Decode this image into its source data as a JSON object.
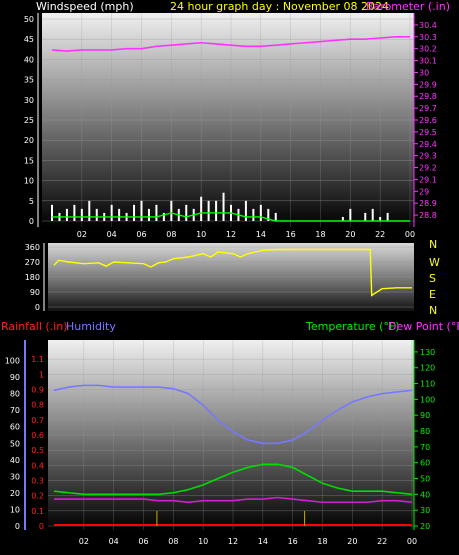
{
  "header": {
    "wind_label": "Windspeed (mph)",
    "date_label": "24 hour graph day : November 08 2024",
    "baro_label": "Barometer (.in)"
  },
  "lower_header": {
    "rain_label": "Rainfall (.in)",
    "humidity_label": "Humidity",
    "temp_label": "Temperature (°F)",
    "dew_label": "Dew Point (°F)"
  },
  "colors": {
    "wind": "#ffffff",
    "gust": "#00ff00",
    "barometer": "#ff33ff",
    "wind_dir": "#ffff00",
    "humidity": "#7878ff",
    "temperature": "#00dd00",
    "dewpoint": "#cc22cc",
    "rain": "#ff0000",
    "rain_rate": "#ccaa00",
    "date_label": "#ffff00",
    "header_white": "#ffffff"
  },
  "compass_labels": [
    "N",
    "W",
    "S",
    "E",
    "N"
  ],
  "chart_data": [
    {
      "type": "line",
      "title": "24 hour graph day : November 08 2024",
      "xlabel": "",
      "ylabel": "Windspeed (mph)",
      "x_ticks": [
        "02",
        "04",
        "06",
        "08",
        "10",
        "12",
        "14",
        "16",
        "18",
        "20",
        "22",
        "00"
      ],
      "ylim": [
        0,
        50
      ],
      "y_ticks": [
        0,
        5,
        10,
        15,
        20,
        25,
        30,
        35,
        40,
        45,
        50
      ],
      "y2label": "Barometer (.in)",
      "y2lim": [
        28.75,
        30.45
      ],
      "y2_ticks": [
        "28.8",
        "28.9",
        "29",
        "29.1",
        "29.2",
        "29.3",
        "29.4",
        "29.5",
        "29.6",
        "29.7",
        "29.8",
        "29.9",
        "30",
        "30.1",
        "30.2",
        "30.3",
        "30.4"
      ],
      "series": [
        {
          "name": "Barometer (.in)",
          "axis": "right",
          "x": [
            0,
            1,
            2,
            3,
            4,
            5,
            6,
            7,
            8,
            9,
            10,
            11,
            12,
            13,
            14,
            15,
            16,
            17,
            18,
            19,
            20,
            21,
            22,
            23,
            24
          ],
          "values": [
            30.19,
            30.18,
            30.19,
            30.19,
            30.19,
            30.2,
            30.2,
            30.22,
            30.23,
            30.24,
            30.25,
            30.24,
            30.23,
            30.22,
            30.22,
            30.23,
            30.24,
            30.25,
            30.26,
            30.27,
            30.28,
            30.28,
            30.29,
            30.3,
            30.3
          ]
        },
        {
          "name": "Windspeed (mph)",
          "axis": "left",
          "x": [
            0,
            0.5,
            1,
            1.5,
            2,
            2.5,
            3,
            3.5,
            4,
            4.5,
            5,
            5.5,
            6,
            6.5,
            7,
            7.5,
            8,
            8.5,
            9,
            9.5,
            10,
            10.5,
            11,
            11.5,
            12,
            12.5,
            13,
            13.5,
            14,
            14.5,
            15,
            16,
            17,
            18,
            19,
            19.5,
            20,
            20.5,
            21,
            21.5,
            22,
            22.5,
            23,
            24
          ],
          "values": [
            4,
            2,
            3,
            4,
            3,
            5,
            3,
            2,
            4,
            3,
            2,
            4,
            5,
            3,
            4,
            2,
            5,
            3,
            4,
            3,
            6,
            5,
            5,
            7,
            4,
            3,
            5,
            3,
            4,
            3,
            2,
            0,
            0,
            0,
            0,
            1,
            3,
            0,
            2,
            3,
            1,
            2,
            0,
            0
          ]
        },
        {
          "name": "Gust",
          "axis": "left",
          "x": [
            0,
            1,
            2,
            3,
            4,
            5,
            6,
            7,
            8,
            9,
            10,
            11,
            12,
            13,
            14,
            15,
            16,
            17,
            18,
            19,
            20,
            21,
            22,
            23,
            24
          ],
          "values": [
            1,
            1,
            1,
            1,
            1,
            1,
            1,
            1,
            2,
            1,
            2,
            2,
            2,
            1,
            1,
            0,
            0,
            0,
            0,
            0,
            0,
            0,
            0,
            0,
            0
          ]
        }
      ]
    },
    {
      "type": "line",
      "title": "",
      "ylabel": "Wind direction",
      "ylim": [
        0,
        360
      ],
      "y_ticks": [
        0,
        90,
        180,
        270,
        360
      ],
      "x_ticks": [],
      "series": [
        {
          "name": "Wind direction",
          "x": [
            0,
            0.3,
            1,
            2,
            3,
            3.5,
            4,
            5,
            6,
            6.5,
            7,
            7.5,
            8,
            9,
            9.5,
            10,
            10.5,
            11,
            12,
            12.5,
            13,
            13.5,
            14,
            15,
            16,
            17,
            18,
            19,
            20,
            21,
            21.2,
            21.3,
            22,
            23,
            24
          ],
          "values": [
            250,
            280,
            270,
            260,
            265,
            245,
            270,
            265,
            260,
            240,
            265,
            270,
            290,
            300,
            310,
            320,
            300,
            330,
            320,
            300,
            320,
            330,
            340,
            345,
            345,
            345,
            345,
            345,
            345,
            345,
            345,
            70,
            110,
            115,
            115
          ]
        }
      ]
    },
    {
      "type": "line",
      "title": "",
      "xlabel": "",
      "ylabel": "Rainfall (.in)",
      "x_ticks": [
        "02",
        "04",
        "06",
        "08",
        "10",
        "12",
        "14",
        "16",
        "18",
        "20",
        "22",
        "00"
      ],
      "ylim": [
        0,
        1.2
      ],
      "y_ticks": [
        "0",
        "0.1",
        "0.2",
        "0.3",
        "0.4",
        "0.5",
        "0.6",
        "0.7",
        "0.8",
        "0.9",
        "1",
        "1.1"
      ],
      "humidity_ticks": [
        0,
        10,
        20,
        30,
        40,
        50,
        60,
        70,
        80,
        90,
        100
      ],
      "y2label": "Temperature (°F)",
      "y2lim": [
        20,
        135
      ],
      "y2_ticks": [
        20,
        30,
        40,
        50,
        60,
        70,
        80,
        90,
        100,
        110,
        120,
        130
      ],
      "series": [
        {
          "name": "Humidity",
          "axis": "humidity",
          "x": [
            0,
            1,
            2,
            3,
            4,
            5,
            6,
            7,
            8,
            9,
            10,
            11,
            12,
            13,
            14,
            15,
            16,
            17,
            18,
            19,
            20,
            21,
            22,
            23,
            24
          ],
          "values": [
            82,
            84,
            85,
            85,
            84,
            84,
            84,
            84,
            83,
            80,
            73,
            64,
            57,
            52,
            50,
            50,
            52,
            57,
            64,
            70,
            75,
            78,
            80,
            81,
            82
          ]
        },
        {
          "name": "Temperature (°F)",
          "axis": "right",
          "x": [
            0,
            1,
            2,
            3,
            4,
            5,
            6,
            7,
            8,
            9,
            10,
            11,
            12,
            13,
            14,
            15,
            16,
            17,
            18,
            19,
            20,
            21,
            22,
            23,
            24
          ],
          "values": [
            42,
            41,
            40,
            40,
            40,
            40,
            40,
            40,
            41,
            43,
            46,
            50,
            54,
            57,
            59,
            59,
            57,
            52,
            47,
            44,
            42,
            42,
            42,
            41,
            40
          ]
        },
        {
          "name": "Dew Point (°F)",
          "axis": "right",
          "x": [
            0,
            1,
            2,
            3,
            4,
            5,
            6,
            7,
            8,
            9,
            10,
            11,
            12,
            13,
            14,
            15,
            16,
            17,
            18,
            19,
            20,
            21,
            22,
            23,
            24
          ],
          "values": [
            37,
            37,
            37,
            37,
            37,
            37,
            37,
            36,
            36,
            35,
            36,
            36,
            36,
            37,
            37,
            38,
            37,
            36,
            35,
            35,
            35,
            35,
            36,
            36,
            35
          ]
        },
        {
          "name": "Rainfall (.in)",
          "axis": "left",
          "x": [
            0,
            24
          ],
          "values": [
            0,
            0
          ]
        },
        {
          "name": "Rain rate",
          "axis": "left",
          "x": [
            6.9,
            16.8
          ],
          "values": [
            0.1,
            0.1
          ]
        }
      ]
    }
  ]
}
